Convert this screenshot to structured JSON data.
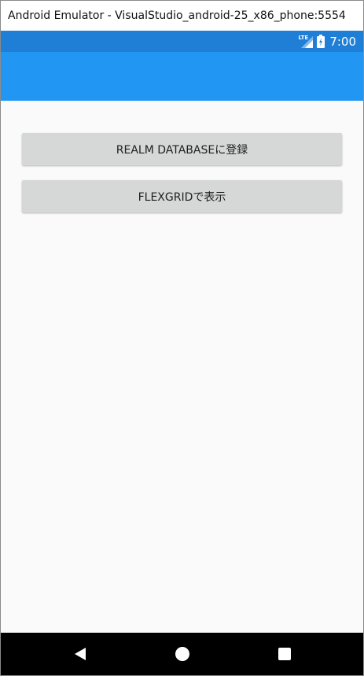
{
  "window": {
    "title": "Android Emulator - VisualStudio_android-25_x86_phone:5554"
  },
  "status_bar": {
    "network_label": "LTE",
    "time": "7:00",
    "icons": [
      "lte-signal-icon",
      "battery-icon"
    ]
  },
  "app_bar": {
    "color": "#2196f3"
  },
  "buttons": {
    "register_label": "REALM DATABASEに登録",
    "show_label": "FLEXGRIDで表示"
  },
  "nav_bar": {
    "icons": [
      "back-icon",
      "home-icon",
      "recent-apps-icon"
    ]
  },
  "colors": {
    "status_bar": "#1f7fd6",
    "app_bar": "#2196f3",
    "button": "#d6d7d7",
    "background": "#fafafa",
    "nav_bar": "#000000"
  }
}
